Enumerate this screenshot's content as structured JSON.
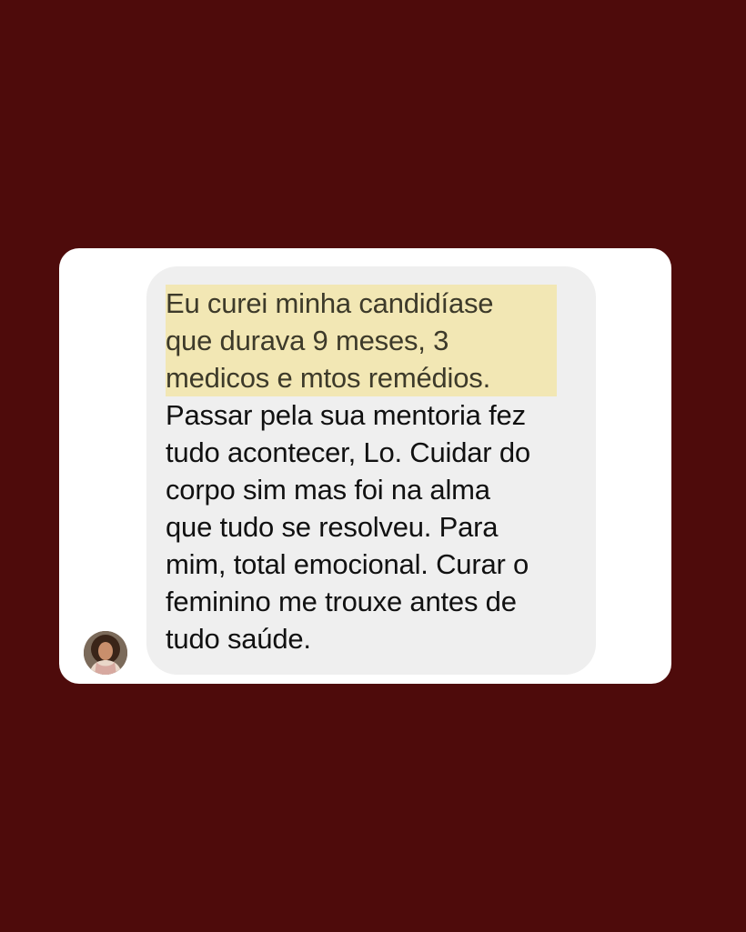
{
  "message": {
    "highlighted_lines": [
      "Eu curei minha candidíase",
      "que durava 9 meses, 3",
      "medicos e mtos remédios."
    ],
    "body_lines": [
      "Passar pela sua mentoria fez",
      "tudo acontecer, Lo. Cuidar do",
      "corpo sim mas foi na alma",
      "que tudo se resolveu. Para",
      "mim, total emocional. Curar o",
      "feminino me trouxe antes de",
      "tudo saúde."
    ]
  },
  "colors": {
    "background": "#4e0b0b",
    "card": "#ffffff",
    "bubble": "#efefef",
    "highlight": "#f2e7b4"
  },
  "sender": {
    "avatar_icon": "profile-photo-icon"
  }
}
